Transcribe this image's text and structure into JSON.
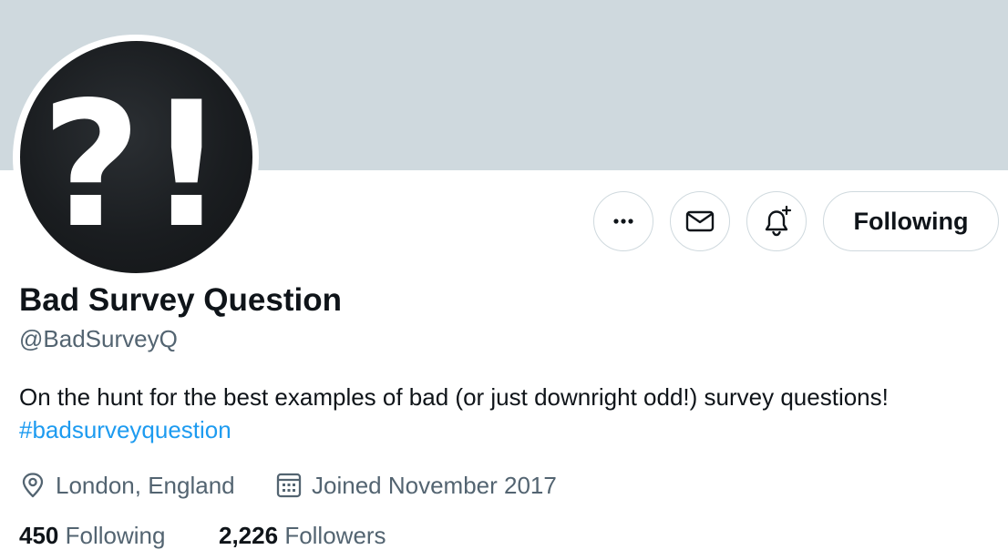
{
  "profile": {
    "display_name": "Bad Survey Question",
    "handle": "@BadSurveyQ",
    "avatar_text": "?!",
    "bio_text": "On the hunt for the best examples of bad (or just downright odd!) survey questions!",
    "bio_hashtag": "#badsurveyquestion",
    "location": "London, England",
    "joined": "Joined November 2017"
  },
  "actions": {
    "more_icon": "more-horizontal-icon",
    "message_icon": "mail-icon",
    "notify_icon": "bell-plus-icon",
    "follow_label": "Following"
  },
  "stats": {
    "following_count": "450",
    "following_label": "Following",
    "followers_count": "2,226",
    "followers_label": "Followers"
  },
  "colors": {
    "banner": "#cfd9de",
    "accent": "#1d9bf0",
    "text_primary": "#0f1419",
    "text_secondary": "#536471",
    "border": "#cfd9de"
  }
}
